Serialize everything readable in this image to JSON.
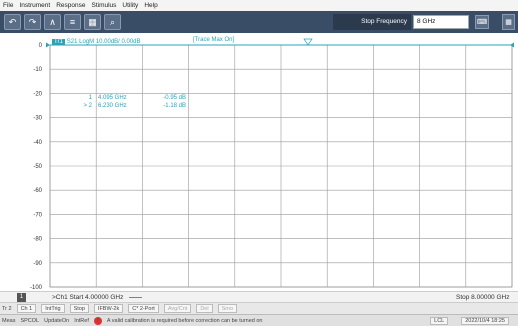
{
  "menu": [
    "File",
    "Instrument",
    "Response",
    "Stimulus",
    "Utility",
    "Help"
  ],
  "toolbar": {
    "buttons": [
      "undo-icon",
      "redo-icon",
      "marker-icon",
      "trace-icon",
      "grid-icon",
      "zoom-icon"
    ],
    "stop_frequency_label": "Stop Frequency",
    "stop_frequency_value": "8 GHz"
  },
  "trace": {
    "id": "Tr1",
    "label": "S21 LogM 10.00dB/ 0.00dB",
    "max_label": "[Trace Max On]",
    "color": "#2aa3b8"
  },
  "markers": [
    {
      "index": "1",
      "freq": "4.095 GHz",
      "value": "-0.95 dB"
    },
    {
      "index": "> 2",
      "freq": "6.230 GHz",
      "value": "-1.18 dB"
    }
  ],
  "chart_data": {
    "type": "line",
    "y_ticks": [
      "0",
      "-10",
      "-20",
      "-30",
      "-40",
      "-50",
      "-60",
      "-70",
      "-80",
      "-90",
      "-100"
    ],
    "ylim": [
      -100,
      0
    ],
    "x_divisions": 10,
    "grid": true,
    "series": [
      {
        "x": [
          0,
          8
        ],
        "y": [
          0,
          0
        ]
      }
    ]
  },
  "stimulus": {
    "channel_badge": "1",
    "start": ">Ch1  Start  4.00000 GHz",
    "stop": "Stop  8.00000 GHz"
  },
  "channel_bar": [
    "Tr 2",
    "Ch 1",
    "IntTrig",
    "Stop",
    "IFBW-2k",
    "C* 2-Port",
    "Avg/Cnt",
    "Del",
    "Smo"
  ],
  "status": {
    "items": [
      "Meas",
      "SPCOL",
      "UpdateOn",
      "IntRef"
    ],
    "warning": "A valid calibration is required before correction can be turned on",
    "right": [
      "LCL",
      "2022/10/4 18:25"
    ]
  }
}
